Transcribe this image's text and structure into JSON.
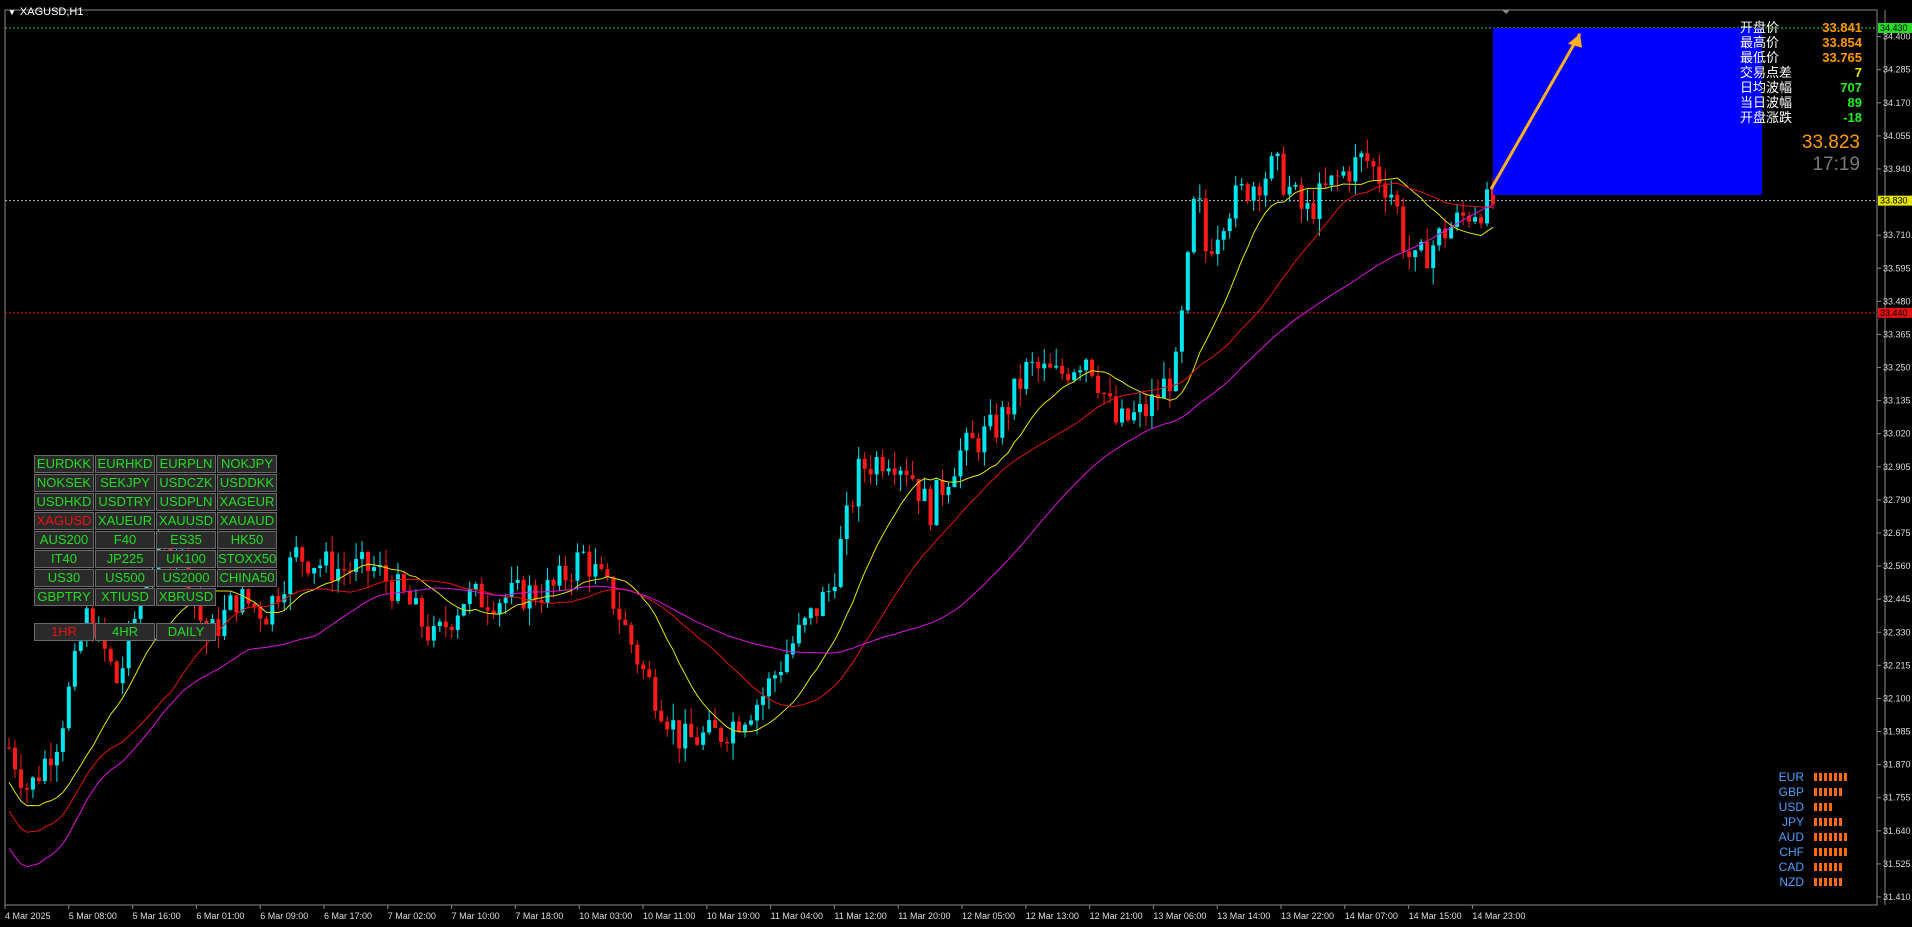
{
  "window": {
    "title": "XAGUSD,H1"
  },
  "colors": {
    "bull": "#00e5ee",
    "bear": "#ff1a1a",
    "ma_fast": "#e5e500",
    "ma_mid": "#e51010",
    "ma_slow": "#e010e0",
    "projection": "#0000ff",
    "arrow": "#ffb020",
    "label_orange": "#ff9900",
    "label_green": "#22dd22",
    "currency_blue": "#4aa0ff",
    "strength_bar": "#ff6a10"
  },
  "info_panel": [
    {
      "label": "开盘价",
      "value": "33.841",
      "color": "#ff9900"
    },
    {
      "label": "最高价",
      "value": "33.854",
      "color": "#ff9900"
    },
    {
      "label": "最低价",
      "value": "33.765",
      "color": "#ff9900"
    },
    {
      "label": "交易点差",
      "value": "7",
      "color": "#e5e500"
    },
    {
      "label": "日均波幅",
      "value": "707",
      "color": "#22ee22"
    },
    {
      "label": "当日波幅",
      "value": "89",
      "color": "#22ee22"
    },
    {
      "label": "开盘涨跌",
      "value": "-18",
      "color": "#22ee22"
    }
  ],
  "current_price": "33.823",
  "bar_countdown": "17:19",
  "symbol_buttons": [
    "EURDKK",
    "EURHKD",
    "EURPLN",
    "NOKJPY",
    "NOKSEK",
    "SEKJPY",
    "USDCZK",
    "USDDKK",
    "USDHKD",
    "USDTRY",
    "USDPLN",
    "XAGEUR",
    "XAGUSD",
    "XAUEUR",
    "XAUUSD",
    "XAUAUD",
    "AUS200",
    "F40",
    "ES35",
    "HK50",
    "IT40",
    "JP225",
    "UK100",
    "STOXX50",
    "US30",
    "US500",
    "US2000",
    "CHINA50",
    "GBPTRY",
    "XTIUSD",
    "XBRUSD"
  ],
  "active_symbol": "XAGUSD",
  "timeframe_buttons": [
    "1HR",
    "4HR",
    "DAILY"
  ],
  "active_timeframe": "1HR",
  "currency_strength": [
    {
      "name": "EUR",
      "level": 7
    },
    {
      "name": "GBP",
      "level": 6
    },
    {
      "name": "USD",
      "level": 4
    },
    {
      "name": "JPY",
      "level": 6
    },
    {
      "name": "AUD",
      "level": 7
    },
    {
      "name": "CHF",
      "level": 7
    },
    {
      "name": "CAD",
      "level": 6
    },
    {
      "name": "NZD",
      "level": 6
    }
  ],
  "chart_data": {
    "type": "candlestick",
    "symbol": "XAGUSD",
    "timeframe": "H1",
    "ylim": [
      31.41,
      34.43
    ],
    "y_ticks": [
      "34.400",
      "34.285",
      "34.170",
      "34.055",
      "33.940",
      "33.710",
      "33.595",
      "33.480",
      "33.365",
      "33.250",
      "33.135",
      "33.020",
      "32.905",
      "32.790",
      "32.675",
      "32.560",
      "32.445",
      "32.330",
      "32.215",
      "32.100",
      "31.985",
      "31.870",
      "31.755",
      "31.640",
      "31.525",
      "31.410"
    ],
    "x_ticks": [
      "4 Mar 2025",
      "5 Mar 08:00",
      "5 Mar 16:00",
      "6 Mar 01:00",
      "6 Mar 09:00",
      "6 Mar 17:00",
      "7 Mar 02:00",
      "7 Mar 10:00",
      "7 Mar 18:00",
      "10 Mar 03:00",
      "10 Mar 11:00",
      "10 Mar 19:00",
      "11 Mar 04:00",
      "11 Mar 12:00",
      "11 Mar 20:00",
      "12 Mar 05:00",
      "12 Mar 13:00",
      "12 Mar 21:00",
      "13 Mar 06:00",
      "13 Mar 14:00",
      "13 Mar 22:00",
      "14 Mar 07:00",
      "14 Mar 15:00",
      "14 Mar 23:00"
    ],
    "price_labels": [
      {
        "value": 34.43,
        "text": "34.430",
        "color": "#22dd22",
        "line": "dotted"
      },
      {
        "value": 33.83,
        "text": "33.830",
        "color": "#e5e500",
        "line": "dotted-white"
      },
      {
        "value": 33.44,
        "text": "33.440",
        "color": "#e51010",
        "line": "dotted"
      }
    ],
    "projection_box": {
      "x_from": 245,
      "x_to": 288,
      "y_from": 33.85,
      "y_to": 34.43
    },
    "arrow": {
      "x_from": 248,
      "y_from": 33.87,
      "x_to": 260,
      "y_to": 34.41
    },
    "candle_count": 249
  }
}
